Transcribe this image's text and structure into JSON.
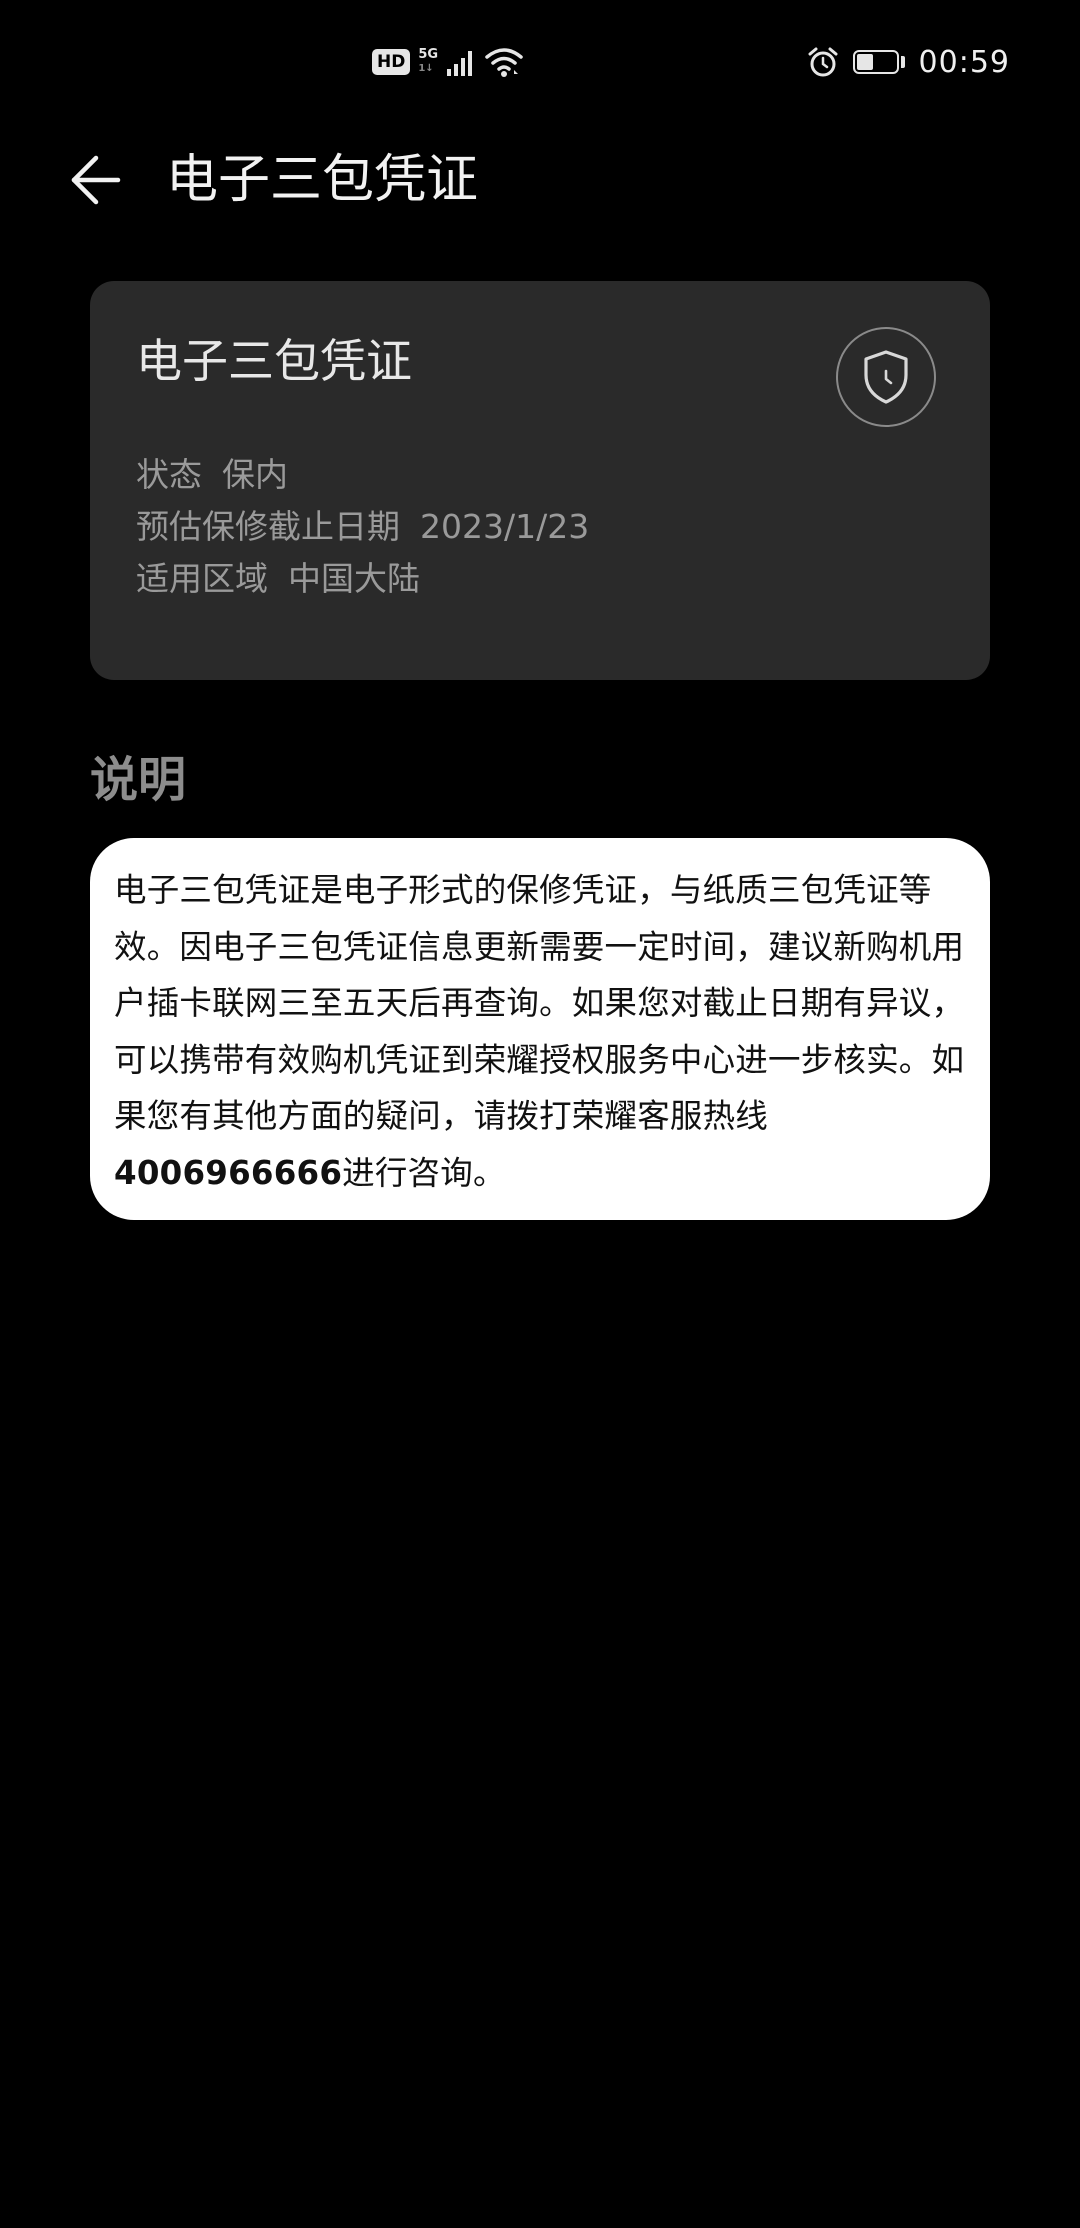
{
  "status_bar": {
    "hd_label": "HD",
    "network_label": "5G",
    "network_sub": "1↓",
    "battery_level": "39",
    "battery_fraction": 0.39,
    "time": "00:59"
  },
  "header": {
    "title": "电子三包凭证",
    "back_icon": "arrow-left-icon"
  },
  "warranty_card": {
    "title": "电子三包凭证",
    "badge_icon": "shield-clock-icon",
    "rows": [
      {
        "label": "状态",
        "value": "保内"
      },
      {
        "label": "预估保修截止日期",
        "value": "2023/1/23"
      },
      {
        "label": "适用区域",
        "value": "中国大陆"
      }
    ]
  },
  "description": {
    "heading": "说明",
    "text_part1": "电子三包凭证是电子形式的保修凭证，与纸质三包凭证等效。因电子三包凭证信息更新需要一定时间，建议新购机用户插卡联网三至五天后再查询。如果您对截止日期有异议，可以携带有效购机凭证到荣耀授权服务中心进一步核实。如果您有其他方面的疑问，请拨打荣耀客服热线",
    "hotline": "4006966666",
    "text_part2": "进行咨询。"
  },
  "colors": {
    "background": "#000000",
    "card_background": "#2a2a2a",
    "description_background": "#ffffff",
    "muted_text": "#9a9a9a"
  }
}
